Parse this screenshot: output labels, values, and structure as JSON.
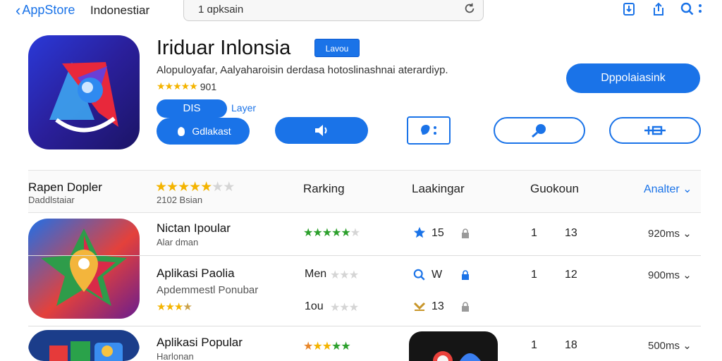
{
  "topbar": {
    "back_label": "AppStore",
    "title": "Indonestiar",
    "search_value": "1 ɑpksain"
  },
  "app": {
    "name": "Iriduar Inlonsia",
    "badge": "Lavou",
    "description": "Alopuloyafar, Aalyaharoisin derdasa hotoslinashnai aterardiyp.",
    "rating_count": "901",
    "primary_button": "Dppolaiasink",
    "dis_label": "DIS",
    "layer_label": "Layer",
    "get_button": "Gdlakast"
  },
  "list_header": {
    "title": "Rapen Dopler",
    "subtitle": "Daddlstaiar",
    "stars_sub": "2102 Bsian",
    "col_ranking": "Rarking",
    "col_looking": "Laakingar",
    "col_count": "Guokoun",
    "analyze": "Analter"
  },
  "rows": [
    {
      "title": "Nictan Ipoular",
      "subtitle": "Alar dman",
      "rank_a": "15",
      "count_a": "1",
      "count_b": "13",
      "size": "920ms"
    },
    {
      "title": "Aplikasi Paolia",
      "subtitle": "Apdemmestl Ponubar",
      "rank_label_1": "Men",
      "rank_label_2": "1ou",
      "look_1": "W",
      "look_2": "13",
      "count_a": "1",
      "count_b": "12",
      "size": "900ms"
    },
    {
      "title": "Aplikasi Popular",
      "subtitle": "Harlonan",
      "count_a": "1",
      "count_b": "18",
      "size": "500ms"
    }
  ],
  "colors": {
    "accent": "#1a73e8",
    "star_gold": "#f4b400",
    "star_green": "#2ca02c"
  }
}
